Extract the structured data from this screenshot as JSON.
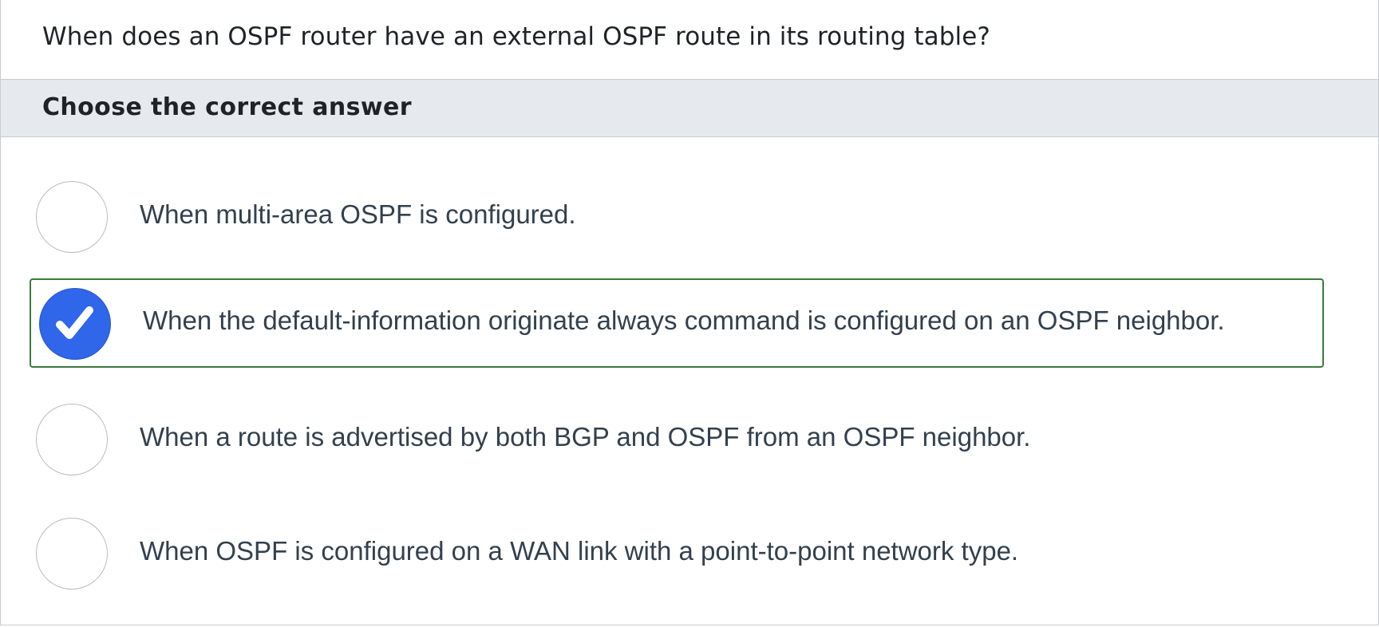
{
  "question": {
    "text": "When does an OSPF router have an external OSPF route in its routing table?"
  },
  "instruction": {
    "text": "Choose the correct answer"
  },
  "options": [
    {
      "label": "When multi-area OSPF is configured.",
      "selected": false
    },
    {
      "label": "When the default-information originate always command is configured on an OSPF neighbor.",
      "selected": true
    },
    {
      "label": "When a route is advertised by both BGP and OSPF from an OSPF neighbor.",
      "selected": false
    },
    {
      "label": "When OSPF is configured on a WAN link with a point-to-point network type.",
      "selected": false
    }
  ],
  "colors": {
    "selected_radio": "#2f66ea",
    "selected_border": "#3b7a3b",
    "instruction_bar_bg": "#e6e9ed"
  },
  "icons": {
    "selected_mark": "checkmark-icon"
  }
}
